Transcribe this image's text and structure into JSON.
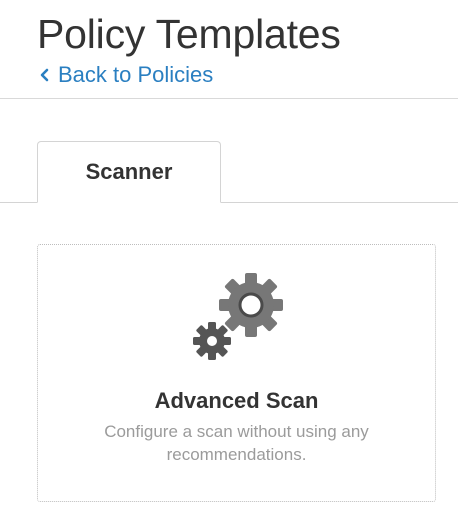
{
  "header": {
    "title": "Policy Templates",
    "back_link": "Back to Policies",
    "back_icon": "chevron-left-icon"
  },
  "tabs": [
    {
      "label": "Scanner",
      "active": true
    }
  ],
  "templates": [
    {
      "icon": "gears-icon",
      "title": "Advanced Scan",
      "description": "Configure a scan without using any recommendations."
    }
  ],
  "colors": {
    "link": "#2a7fc1",
    "text": "#333333",
    "muted": "#9b9b9b",
    "gear_dark": "#555555",
    "gear_light": "#777777"
  }
}
